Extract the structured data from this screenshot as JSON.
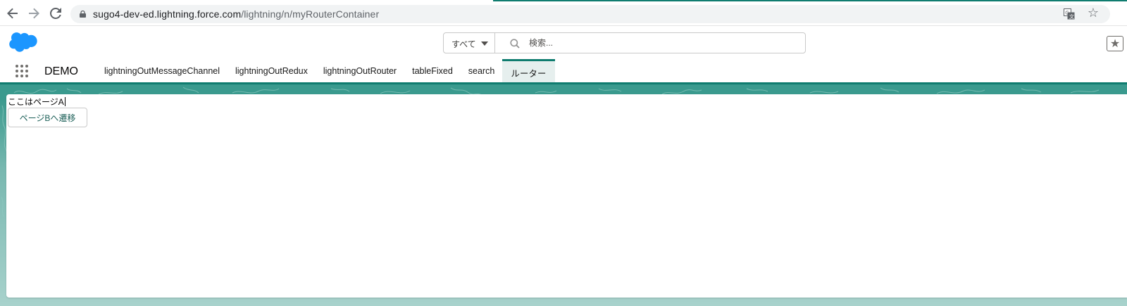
{
  "browser": {
    "url_host": "sugo4-dev-ed.lightning.force.com",
    "url_path": "/lightning/n/myRouterContainer",
    "icons": [
      "back-arrow-icon",
      "forward-arrow-icon",
      "reload-icon",
      "lock-icon",
      "translate-icon",
      "bookmark-star-icon"
    ]
  },
  "header": {
    "logo": "salesforce-cloud-logo",
    "search_scope": "すべて",
    "search_placeholder": "検索...",
    "favorites_icon": "star-icon"
  },
  "app_nav": {
    "app_name": "DEMO",
    "tabs": [
      {
        "label": "lightningOutMessageChannel",
        "active": false
      },
      {
        "label": "lightningOutRedux",
        "active": false
      },
      {
        "label": "lightningOutRouter",
        "active": false
      },
      {
        "label": "tableFixed",
        "active": false
      },
      {
        "label": "search",
        "active": false
      },
      {
        "label": "ルーター",
        "active": true
      }
    ]
  },
  "page": {
    "text": "ここはページA",
    "button_label": "ページBへ遷移"
  },
  "colors": {
    "brand_teal": "#0f7c6f",
    "salesforce_blue": "#1b96ff",
    "backdrop_top": "#3a9a8e",
    "backdrop_bottom": "#a8d2cc"
  }
}
